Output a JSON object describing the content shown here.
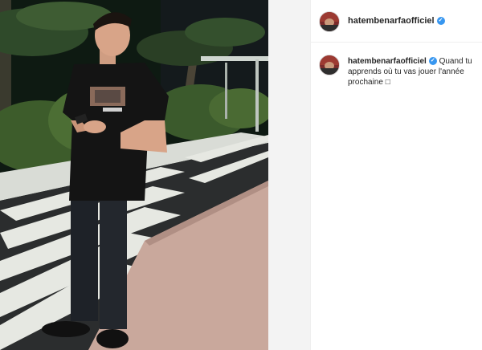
{
  "post": {
    "username": "hatembenarfaofficiel",
    "verified_icon": "verified-badge-icon",
    "caption": "Quand tu apprends où tu vas jouer l'année prochaine",
    "caption_emoji": "□"
  },
  "colors": {
    "verified": "#3897f0",
    "text": "#262626",
    "panel_bg": "#ffffff",
    "page_bg": "#fafafa"
  }
}
